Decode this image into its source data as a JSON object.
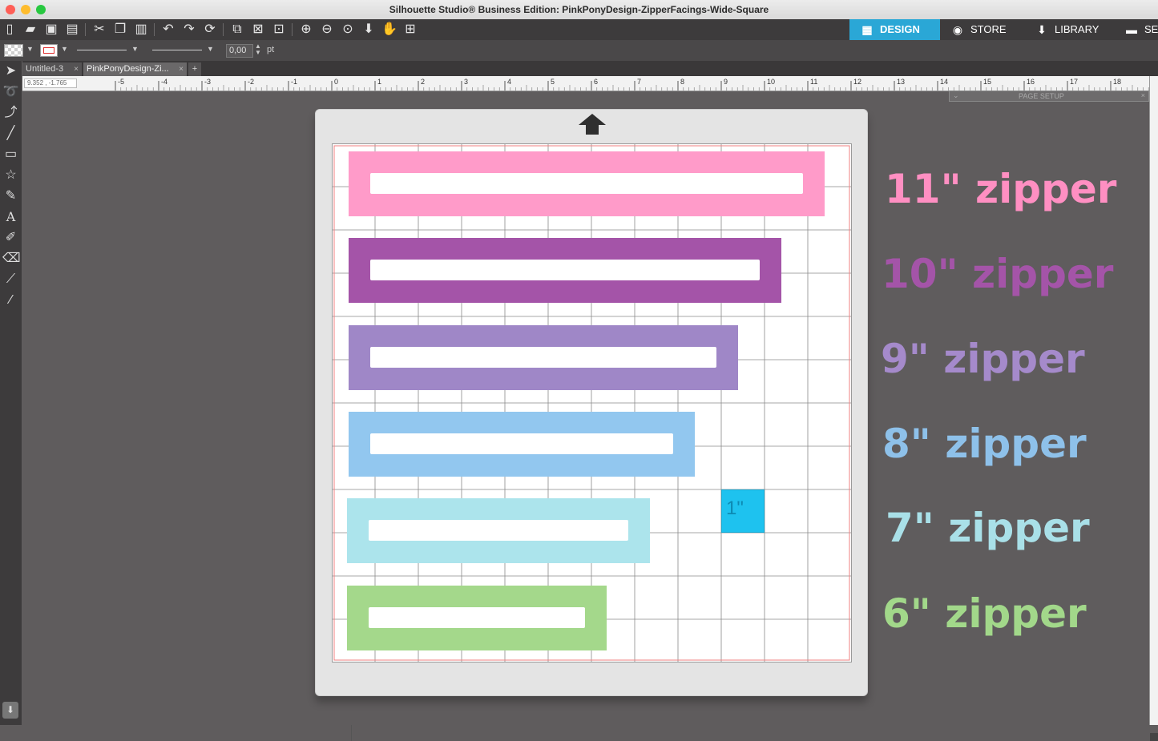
{
  "window": {
    "title": "Silhouette Studio® Business Edition: PinkPonyDesign-ZipperFacings-Wide-Square"
  },
  "nav_tabs": [
    {
      "label": "DESIGN",
      "icon": "grid-icon",
      "active": true
    },
    {
      "label": "STORE",
      "icon": "store-icon",
      "active": false
    },
    {
      "label": "LIBRARY",
      "icon": "library-icon",
      "active": false
    },
    {
      "label": "SE",
      "icon": "send-icon",
      "active": false
    }
  ],
  "properties": {
    "line_width_value": "0,00",
    "line_width_unit": "pt"
  },
  "doc_tabs": [
    {
      "label": "Untitled-3",
      "close": "×"
    },
    {
      "label": "PinkPonyDesign-Zi...",
      "close": "×"
    },
    {
      "label": "+"
    }
  ],
  "ruler": {
    "coordinates": "9.352 , -1.765",
    "ticks": [
      "-5",
      "-4",
      "-3",
      "-2",
      "-1",
      "0",
      "1",
      "2",
      "3",
      "4",
      "5",
      "6",
      "7",
      "8",
      "9",
      "10",
      "11",
      "12",
      "13",
      "14",
      "15",
      "16",
      "17",
      "18"
    ]
  },
  "page_setup_label": "PAGE SETUP",
  "design": {
    "scale_square_label": "1\"",
    "zippers": [
      {
        "label": "11\" zipper",
        "color": "#ff9bc9",
        "label_color": "#ff8fc2",
        "length_in": 11
      },
      {
        "label": "10\" zipper",
        "color": "#a454a8",
        "label_color": "#a454a8",
        "length_in": 10
      },
      {
        "label": "9\" zipper",
        "color": "#9f87c7",
        "label_color": "#a58acb",
        "length_in": 9
      },
      {
        "label": "8\" zipper",
        "color": "#92c7ef",
        "label_color": "#8ec1ea",
        "length_in": 8
      },
      {
        "label": "7\" zipper",
        "color": "#ace4ec",
        "label_color": "#a9e0e8",
        "length_in": 7
      },
      {
        "label": "6\" zipper",
        "color": "#a4d88b",
        "label_color": "#a2d88a",
        "length_in": 6
      }
    ],
    "scale_square_color": "#1ec2ef"
  },
  "colors": {
    "accent_tab": "#2aa7d6",
    "toolbar_bg": "#3d3b3c",
    "workspace_bg": "#5f5c5d"
  }
}
